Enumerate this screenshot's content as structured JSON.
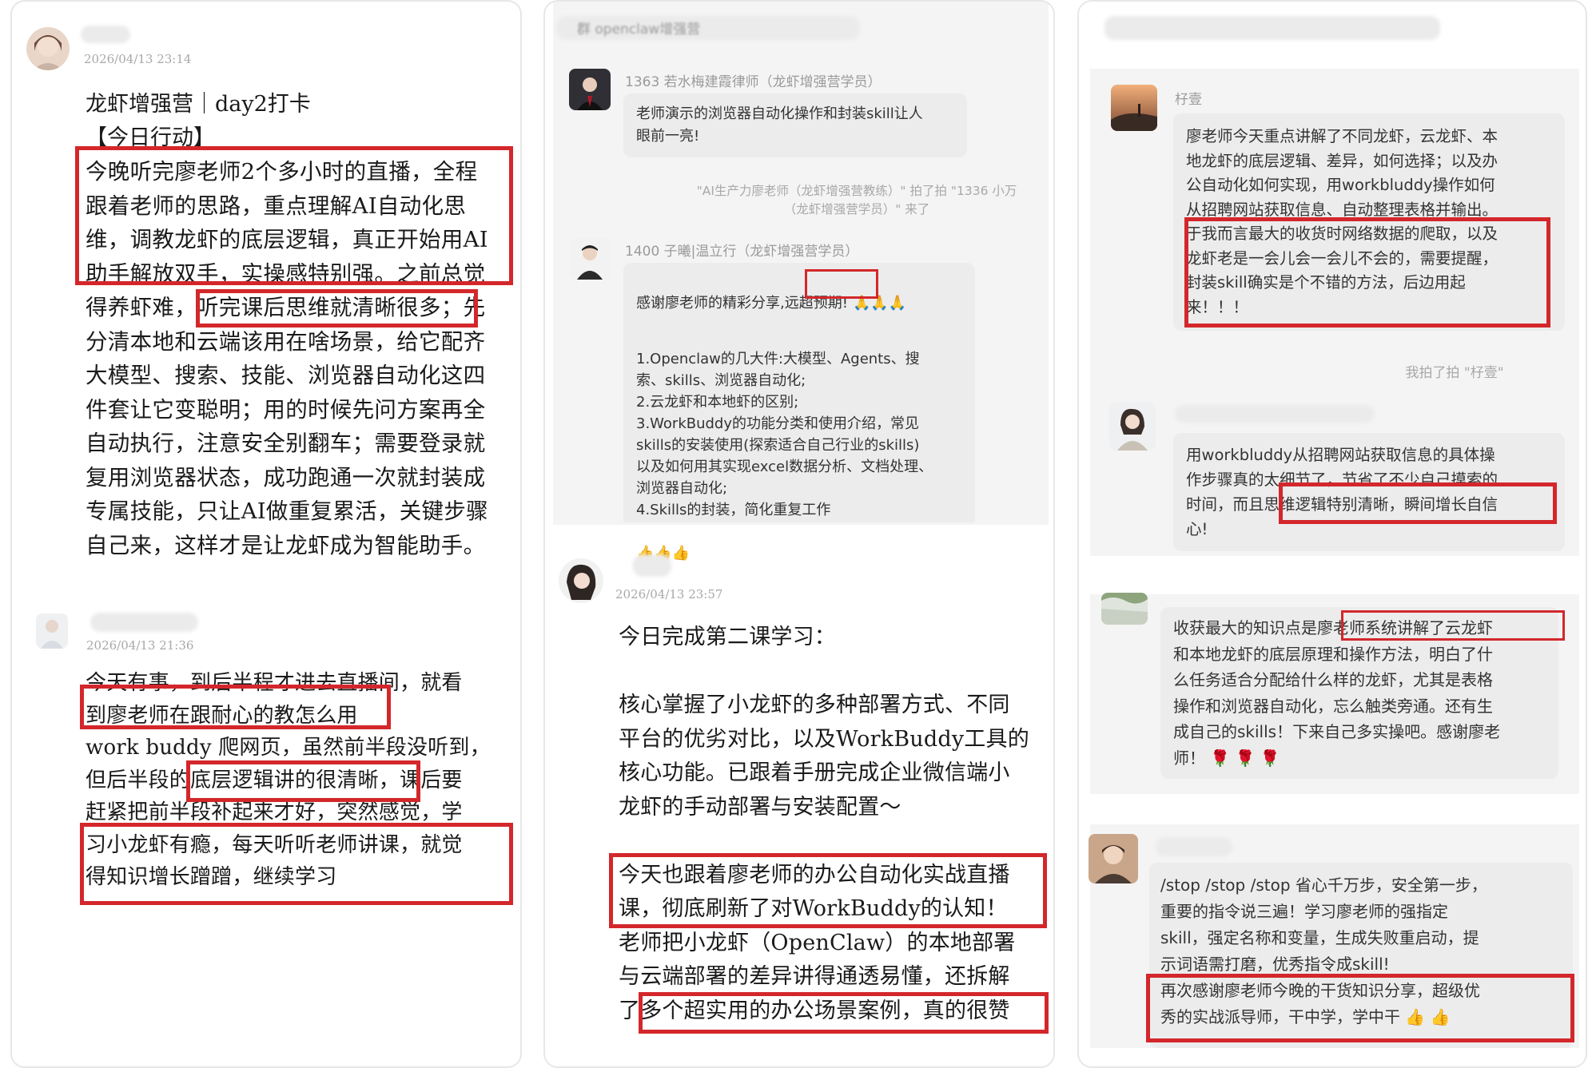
{
  "left": {
    "post1": {
      "date": "2026/04/13 23:14",
      "title_lines": "龙虾增强营｜day2打卡\n【今日行动】",
      "body": "今晚听完廖老师2个多小时的直播，全程\n跟着老师的思路，重点理解AI自动化思\n维，调教龙虾的底层逻辑，真正开始用AI\n助手解放双手，实操感特别强。之前总觉\n得养虾难，听完课后思维就清晰很多；先\n分清本地和云端该用在啥场景，给它配齐\n大模型、搜索、技能、浏览器自动化这四\n件套让它变聪明；用的时候先问方案再全\n自动执行，注意安全别翻车；需要登录就\n复用浏览器状态，成功跑通一次就封装成\n专属技能，只让AI做重复累活，关键步骤\n自己来，这样才是让龙虾成为智能助手。"
    },
    "post2": {
      "date": "2026/04/13 21:36",
      "body": "今天有事，到后半程才进去直播间，就看\n到廖老师在跟耐心的教怎么用\nwork buddy 爬网页，虽然前半段没听到，\n但后半段的底层逻辑讲的很清晰，课后要\n赶紧把前半段补起来才好，突然感觉，学\n习小龙虾有瘾，每天听听老师讲课，就觉\n得知识增长蹭蹭，继续学习"
    }
  },
  "middle": {
    "header_fragment": "群 openclaw增强营",
    "msg1": {
      "sender": "1363 若水梅建霞律师（龙虾增强营学员）",
      "text": "老师演示的浏览器自动化操作和封装skill让人\n眼前一亮!"
    },
    "pat_notice": "\"AI生产力廖老师（龙虾增强营教练）\" 拍了拍 \"1336 小万\n（龙虾增强营学员）\" 来了",
    "msg2": {
      "sender": "1400 子曦|温立行（龙虾增强营学员）",
      "line1_prefix": "感谢廖老师的精彩分享,",
      "line1_highlight": "远超预期!",
      "emoji_pray": "🙏🙏🙏",
      "list": "1.Openclaw的几大件:大模型、Agents、搜\n索、skills、浏览器自动化;\n2.云龙虾和本地虾的区别;\n3.WorkBuddy的功能分类和使用介绍，常见\nskills的安装使用(探索适合自己行业的skills)\n以及如何用其实现excel数据分析、文档处理、\n浏览器自动化;\n4.Skills的封装，简化重复工作",
      "emoji_thumbs": "👍👍👍"
    },
    "post3": {
      "date": "2026/04/13 23:57",
      "body": "今日完成第二课学习：\n\n核心掌握了小龙虾的多种部署方式、不同\n平台的优劣对比，以及WorkBuddy工具的\n核心功能。已跟着手册完成企业微信端小\n龙虾的手动部署与安装配置～\n\n今天也跟着廖老师的办公自动化实战直播\n课，彻底刷新了对WorkBuddy的认知！\n老师把小龙虾（OpenClaw）的本地部署\n与云端部署的差异讲得通透易懂，还拆解\n了多个超实用的办公场景案例，真的很赞"
    }
  },
  "right": {
    "msg1": {
      "sender": "杍壹",
      "text": "廖老师今天重点讲解了不同龙虾，云龙虾、本\n地龙虾的底层逻辑、差异，如何选择；以及办\n公自动化如何实现，用workbluddy操作如何\n从招聘网站获取信息、自动整理表格并输出。\n于我而言最大的收货时网络数据的爬取，以及\n龙虾老是一会儿会一会儿不会的，需要提醒，\n封装skill确实是个不错的方法，后边用起\n来！！！"
    },
    "pat_notice": "我拍了拍 \"杍壹\"",
    "msg2": {
      "text": "用workbluddy从招聘网站获取信息的具体操\n作步骤真的太细节了，节省了不少自己摸索的\n时间，而且思维逻辑特别清晰，瞬间增长自信\n心!"
    },
    "msg3": {
      "text": "收获最大的知识点是廖老师系统讲解了云龙虾\n和本地龙虾的底层原理和操作方法，明白了什\n么任务适合分配给什么样的龙虾，尤其是表格\n操作和浏览器自动化，忘么触类旁通。还有生\n成自己的skills！下来自己多实操吧。感谢廖老\n师！ 🌹 🌹 🌹"
    },
    "msg4": {
      "text": "/stop /stop /stop 省心千万步，安全第一步，\n重要的指令说三遍！学习廖老师的强指定\nskill，强定名称和变量，生成失败重启动，提\n示词语需打磨，优秀指令成skill!\n再次感谢廖老师今晚的干货知识分享，超级优\n秀的实战派导师，干中学，学中干 👍 👍"
    }
  },
  "colors": {
    "highlight": "#d3272b",
    "bubble": "#ececec",
    "meta": "#a8a8a8"
  }
}
